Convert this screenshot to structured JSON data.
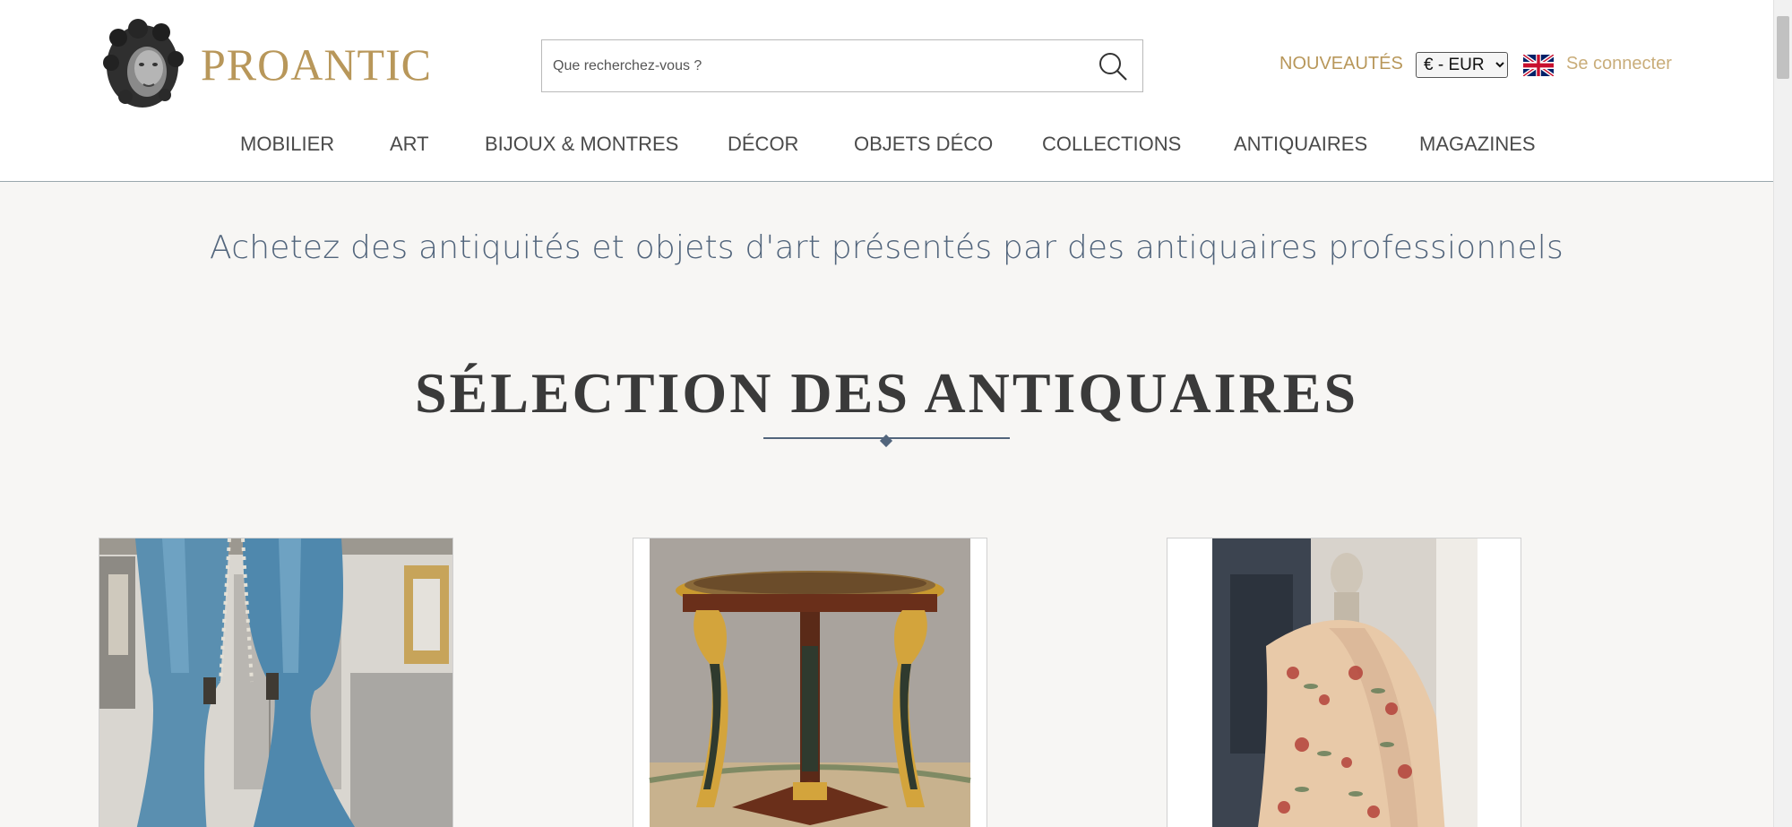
{
  "header": {
    "brand": "PROANTIC",
    "search": {
      "placeholder": "Que recherchez-vous ?",
      "icon": "search-icon"
    },
    "new_label": "NOUVEAUTÉS",
    "currency": {
      "selected": "€ - EUR"
    },
    "language_flag": "uk-flag-icon",
    "login_label": "Se connecter"
  },
  "nav": {
    "items": [
      {
        "label": "MOBILIER"
      },
      {
        "label": "ART"
      },
      {
        "label": "BIJOUX & MONTRES"
      },
      {
        "label": "DÉCOR"
      },
      {
        "label": "OBJETS DÉCO"
      },
      {
        "label": "COLLECTIONS"
      },
      {
        "label": "ANTIQUAIRES"
      },
      {
        "label": "MAGAZINES"
      }
    ]
  },
  "main": {
    "tagline": "Achetez des antiquités et objets d'art présentés par des antiquaires professionnels",
    "section_title": "SÉLECTION DES ANTIQUAIRES"
  },
  "products": [
    {
      "image": "blue-curtains-image"
    },
    {
      "image": "gilded-gueridon-table-image"
    },
    {
      "image": "floral-fabric-bust-image"
    }
  ],
  "colors": {
    "brand_gold": "#b8975a",
    "accent_blue": "#52657c",
    "page_bg": "#f7f6f4"
  }
}
